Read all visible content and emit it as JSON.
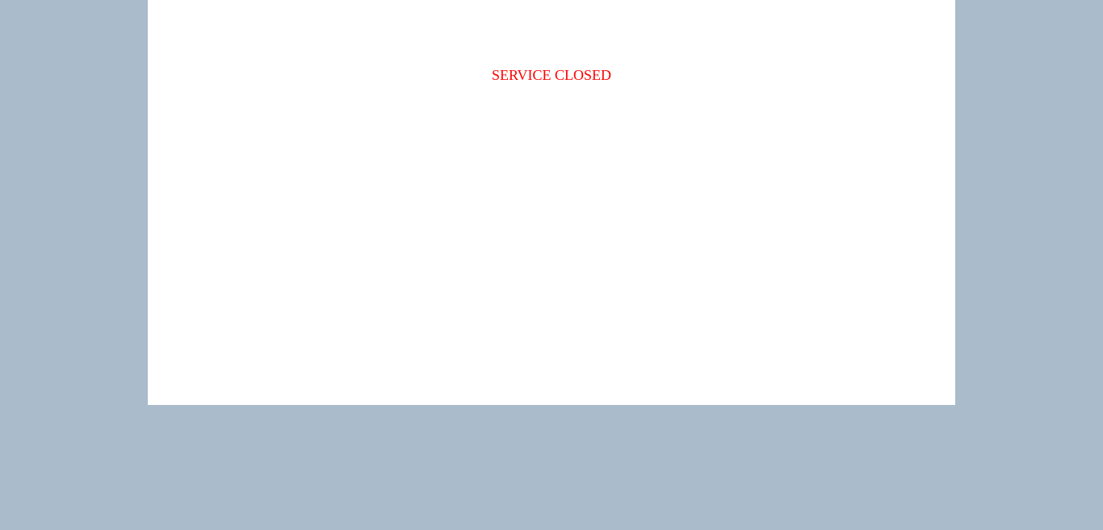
{
  "message": {
    "text": "SERVICE CLOSED",
    "color": "#ff0000"
  },
  "colors": {
    "background": "#aabbcb",
    "panel": "#ffffff"
  }
}
